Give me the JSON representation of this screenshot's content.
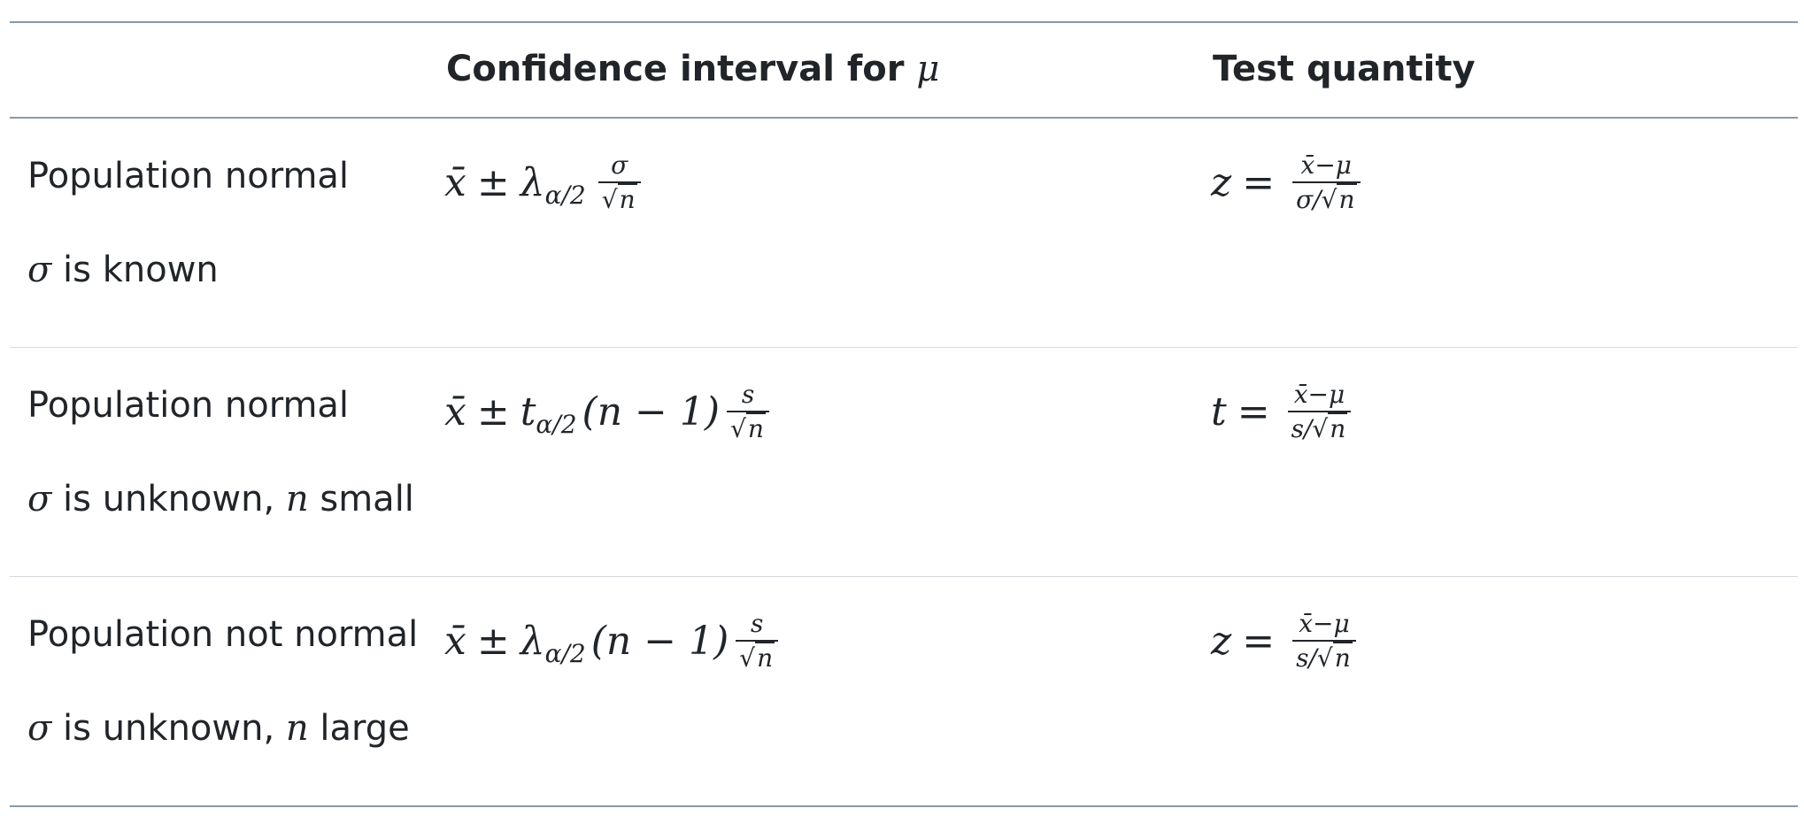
{
  "table": {
    "headers": {
      "condition": "",
      "confidence_interval": "Confidence interval for",
      "confidence_interval_symbol": "μ",
      "test_quantity": "Test quantity"
    },
    "rows": [
      {
        "condition_line1": "Population normal",
        "condition_line2_symbol": "σ",
        "condition_line2_text": "is known",
        "ci": {
          "lead": "x̄",
          "pm": "±",
          "coef": "λ",
          "sub": "α/2",
          "extra": "",
          "num": "σ",
          "den_root": "n"
        },
        "test": {
          "var": "z",
          "eq": "=",
          "num": "x̄−μ",
          "den_pre": "σ/",
          "den_root": "n"
        }
      },
      {
        "condition_line1": "Population normal",
        "condition_line2_symbol": "σ",
        "condition_line2_text": "is unknown,",
        "condition_line2_n": "n",
        "condition_line2_tail": "small",
        "ci": {
          "lead": "x̄",
          "pm": "±",
          "coef": "t",
          "sub": "α/2",
          "extra": "(n − 1)",
          "num": "s",
          "den_root": "n"
        },
        "test": {
          "var": "t",
          "eq": "=",
          "num": "x̄−μ",
          "den_pre": "s/",
          "den_root": "n"
        }
      },
      {
        "condition_line1": "Population not normal",
        "condition_line2_symbol": "σ",
        "condition_line2_text": "is unknown,",
        "condition_line2_n": "n",
        "condition_line2_tail": "large",
        "ci": {
          "lead": "x̄",
          "pm": "±",
          "coef": "λ",
          "sub": "α/2",
          "extra": "(n − 1)",
          "num": "s",
          "den_root": "n"
        },
        "test": {
          "var": "z",
          "eq": "=",
          "num": "x̄−μ",
          "den_pre": "s/",
          "den_root": "n"
        }
      }
    ]
  }
}
